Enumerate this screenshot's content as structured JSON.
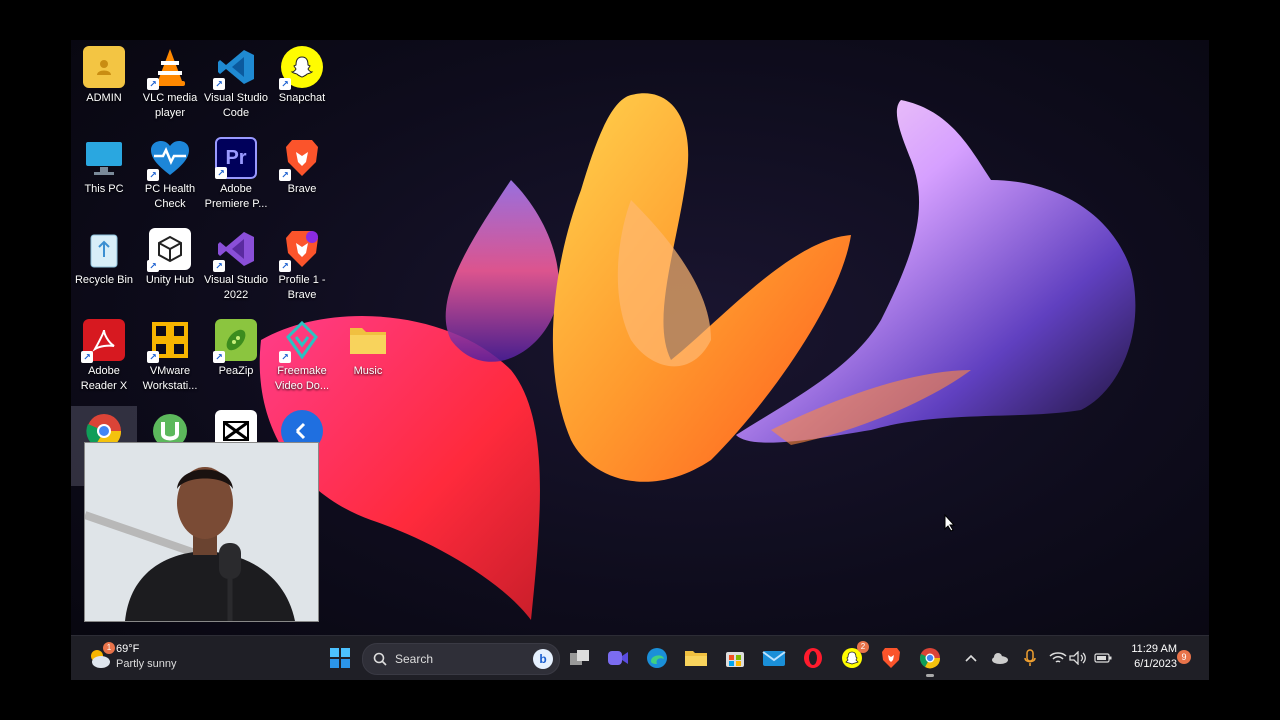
{
  "desktop_icons": [
    {
      "label": "ADMIN",
      "icon": "user-folder-icon"
    },
    {
      "label": "VLC media player",
      "icon": "vlc-icon"
    },
    {
      "label": "Visual Studio Code",
      "icon": "vscode-icon"
    },
    {
      "label": "Snapchat",
      "icon": "snapchat-icon"
    },
    {
      "label": "This PC",
      "icon": "monitor-icon"
    },
    {
      "label": "PC Health Check",
      "icon": "health-check-icon"
    },
    {
      "label": "Adobe Premiere P...",
      "icon": "premiere-icon"
    },
    {
      "label": "Brave",
      "icon": "brave-icon"
    },
    {
      "label": "Recycle Bin",
      "icon": "recycle-bin-icon"
    },
    {
      "label": "Unity Hub",
      "icon": "unity-icon"
    },
    {
      "label": "Visual Studio 2022",
      "icon": "visual-studio-icon"
    },
    {
      "label": "Profile 1 - Brave",
      "icon": "brave-profile-icon"
    },
    {
      "label": "Adobe Reader X",
      "icon": "adobe-reader-icon"
    },
    {
      "label": "VMware Workstati...",
      "icon": "vmware-icon"
    },
    {
      "label": "PeaZip",
      "icon": "peazip-icon"
    },
    {
      "label": "Freemake Video Do...",
      "icon": "freemake-icon"
    },
    {
      "label": "Music",
      "icon": "folder-icon"
    },
    {
      "label": "",
      "icon": "chrome-icon"
    },
    {
      "label": "",
      "icon": "utorrent-icon"
    },
    {
      "label": "",
      "icon": "capcut-icon"
    },
    {
      "label": "",
      "icon": "app-icon"
    }
  ],
  "taskbar": {
    "weather": {
      "temp": "69°F",
      "condition": "Partly sunny",
      "badge": "1"
    },
    "search_placeholder": "Search",
    "snapchat_badge": "2",
    "clock": {
      "time": "11:29 AM",
      "date": "6/1/2023"
    },
    "notification_count": "9"
  }
}
